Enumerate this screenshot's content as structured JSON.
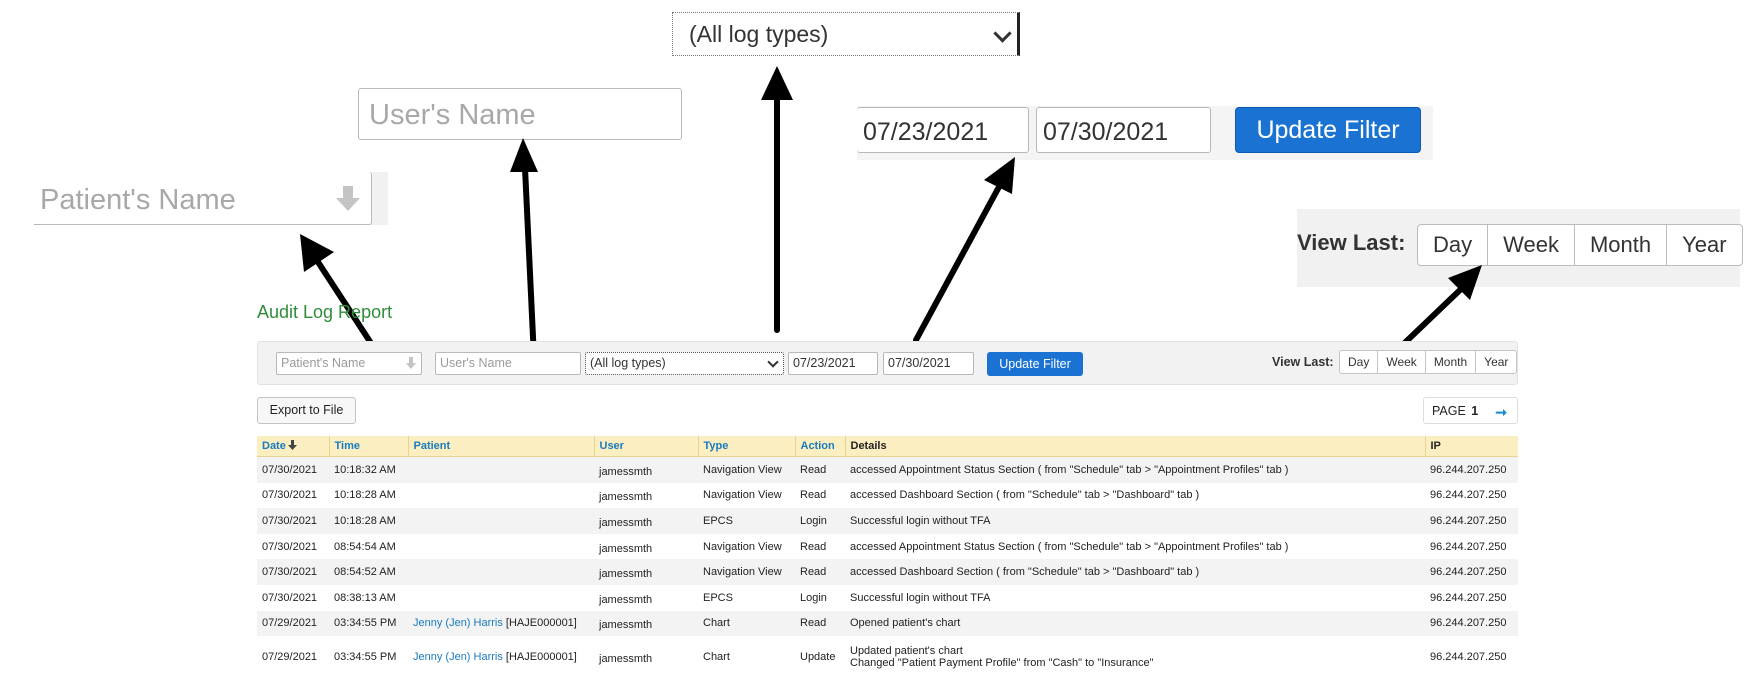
{
  "zoom": {
    "log_type": "(All log types)",
    "user_placeholder": "User's Name",
    "patient_placeholder": "Patient's Name",
    "date_from": "07/23/2021",
    "date_to": "07/30/2021",
    "update_label": "Update Filter",
    "view_last_label": "View Last:",
    "view_options": [
      "Day",
      "Week",
      "Month",
      "Year"
    ]
  },
  "report": {
    "title": "Audit Log Report",
    "filters": {
      "patient_placeholder": "Patient's Name",
      "user_placeholder": "User's Name",
      "log_type": "(All log types)",
      "date_from": "07/23/2021",
      "date_to": "07/30/2021",
      "update_label": "Update Filter",
      "view_last_label": "View Last:",
      "view_options": [
        "Day",
        "Week",
        "Month",
        "Year"
      ]
    },
    "export_label": "Export to File",
    "pager": {
      "label": "PAGE",
      "page": "1"
    },
    "columns": [
      "Date",
      "Time",
      "Patient",
      "User",
      "Type",
      "Action",
      "Details",
      "IP"
    ],
    "rows": [
      {
        "date": "07/30/2021",
        "time": "10:18:32 AM",
        "patient_name": "",
        "patient_id": "",
        "user": "jamessmth",
        "type": "Navigation View",
        "action": "Read",
        "details": "accessed Appointment Status Section ( from \"Schedule\" tab > \"Appointment Profiles\" tab )",
        "details2": "",
        "ip": "96.244.207.250"
      },
      {
        "date": "07/30/2021",
        "time": "10:18:28 AM",
        "patient_name": "",
        "patient_id": "",
        "user": "jamessmth",
        "type": "Navigation View",
        "action": "Read",
        "details": "accessed Dashboard Section ( from \"Schedule\" tab > \"Dashboard\" tab )",
        "details2": "",
        "ip": "96.244.207.250"
      },
      {
        "date": "07/30/2021",
        "time": "10:18:28 AM",
        "patient_name": "",
        "patient_id": "",
        "user": "jamessmth",
        "type": "EPCS",
        "action": "Login",
        "details": "Successful login without TFA",
        "details2": "",
        "ip": "96.244.207.250"
      },
      {
        "date": "07/30/2021",
        "time": "08:54:54 AM",
        "patient_name": "",
        "patient_id": "",
        "user": "jamessmth",
        "type": "Navigation View",
        "action": "Read",
        "details": "accessed Appointment Status Section ( from \"Schedule\" tab > \"Appointment Profiles\" tab )",
        "details2": "",
        "ip": "96.244.207.250"
      },
      {
        "date": "07/30/2021",
        "time": "08:54:52 AM",
        "patient_name": "",
        "patient_id": "",
        "user": "jamessmth",
        "type": "Navigation View",
        "action": "Read",
        "details": "accessed Dashboard Section ( from \"Schedule\" tab > \"Dashboard\" tab )",
        "details2": "",
        "ip": "96.244.207.250"
      },
      {
        "date": "07/30/2021",
        "time": "08:38:13 AM",
        "patient_name": "",
        "patient_id": "",
        "user": "jamessmth",
        "type": "EPCS",
        "action": "Login",
        "details": "Successful login without TFA",
        "details2": "",
        "ip": "96.244.207.250"
      },
      {
        "date": "07/29/2021",
        "time": "03:34:55 PM",
        "patient_name": "Jenny (Jen) Harris",
        "patient_id": "[HAJE000001]",
        "user": "jamessmth",
        "type": "Chart",
        "action": "Read",
        "details": "Opened patient's chart",
        "details2": "",
        "ip": "96.244.207.250"
      },
      {
        "date": "07/29/2021",
        "time": "03:34:55 PM",
        "patient_name": "Jenny (Jen) Harris",
        "patient_id": "[HAJE000001]",
        "user": "jamessmth",
        "type": "Chart",
        "action": "Update",
        "details": "Updated patient's chart",
        "details2": "Changed \"Patient Payment Profile\" from \"Cash\" to \"Insurance\"",
        "ip": "96.244.207.250"
      }
    ]
  }
}
